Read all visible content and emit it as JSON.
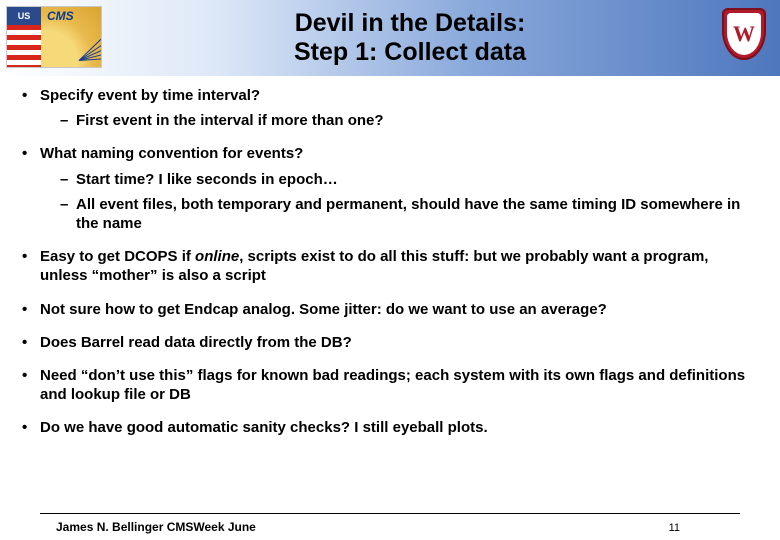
{
  "title": {
    "line1": "Devil in the Details:",
    "line2": "Step 1: Collect data"
  },
  "logos": {
    "left_name": "us-cms-logo",
    "left_us": "US",
    "left_cms": "CMS",
    "right_name": "uw-crest",
    "right_letter": "W"
  },
  "bullets": [
    {
      "text": "Specify event by time interval?",
      "sub": [
        "First event in the interval if more than one?"
      ]
    },
    {
      "text": "What naming convention for events?",
      "sub": [
        "Start time?  I like seconds in epoch…",
        "All event files, both temporary and permanent, should have the same timing ID somewhere in the name"
      ]
    },
    {
      "html": "Easy to get DCOPS if <span class=\"online\">online</span>, scripts exist to do all this stuff:  but we probably want a program, unless “mother” is also a script"
    },
    {
      "text": "Not sure how to get Endcap analog.  Some jitter:  do we want to use an average?"
    },
    {
      "text": "Does Barrel read data directly from the DB?"
    },
    {
      "text": "Need “don’t use this” flags for known bad readings; each system with its own flags and definitions and lookup file or DB"
    },
    {
      "text": "Do we have good automatic sanity checks?   I still eyeball plots."
    }
  ],
  "footer": {
    "author": "James N. Bellinger CMSWeek June",
    "page": "11"
  }
}
